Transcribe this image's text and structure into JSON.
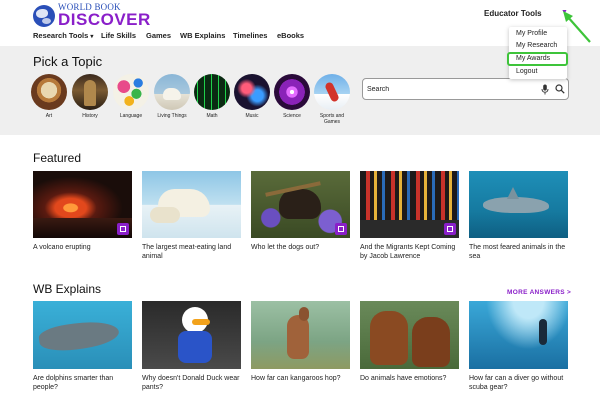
{
  "header": {
    "logo_top": "WORLD BOOK",
    "logo_main": "DISCOVER",
    "user_menu_label": "Educator Tools",
    "user_menu_caret": "▼"
  },
  "nav": [
    {
      "label": "Research Tools",
      "has_dropdown": true
    },
    {
      "label": "Life Skills"
    },
    {
      "label": "Games"
    },
    {
      "label": "WB Explains"
    },
    {
      "label": "Timelines"
    },
    {
      "label": "eBooks"
    }
  ],
  "dropdown": {
    "items": [
      {
        "label": "My Profile"
      },
      {
        "label": "My Research"
      },
      {
        "label": "My Awards",
        "highlighted": true
      },
      {
        "label": "Logout"
      }
    ],
    "highlight_color": "#3ec43a"
  },
  "topics": {
    "heading": "Pick a Topic",
    "items": [
      {
        "label": "Art"
      },
      {
        "label": "History"
      },
      {
        "label": "Language"
      },
      {
        "label": "Living Things"
      },
      {
        "label": "Math"
      },
      {
        "label": "Music"
      },
      {
        "label": "Science"
      },
      {
        "label": "Sports and Games"
      }
    ]
  },
  "search": {
    "placeholder": "Search"
  },
  "featured": {
    "heading": "Featured",
    "items": [
      {
        "caption": "A volcano erupting",
        "image": "volcano"
      },
      {
        "caption": "The largest meat-eating land animal",
        "image": "polar-bear"
      },
      {
        "caption": "Who let the dogs out?",
        "image": "dog"
      },
      {
        "caption": "And the Migrants Kept Coming by Jacob Lawrence",
        "image": "painting"
      },
      {
        "caption": "The most feared animals in the sea",
        "image": "shark"
      }
    ]
  },
  "wb_explains": {
    "heading": "WB Explains",
    "more_label": "MORE ANSWERS >",
    "items": [
      {
        "caption": "Are dolphins smarter than people?",
        "image": "dolphin"
      },
      {
        "caption": "Why doesn't Donald Duck wear pants?",
        "image": "donald-duck"
      },
      {
        "caption": "How far can kangaroos hop?",
        "image": "kangaroo"
      },
      {
        "caption": "Do animals have emotions?",
        "image": "horses"
      },
      {
        "caption": "How far can a diver go without scuba gear?",
        "image": "diver"
      }
    ]
  },
  "colors": {
    "brand_purple": "#8a1fc9",
    "brand_blue": "#2a4fb8",
    "band_gray": "#efefef"
  }
}
